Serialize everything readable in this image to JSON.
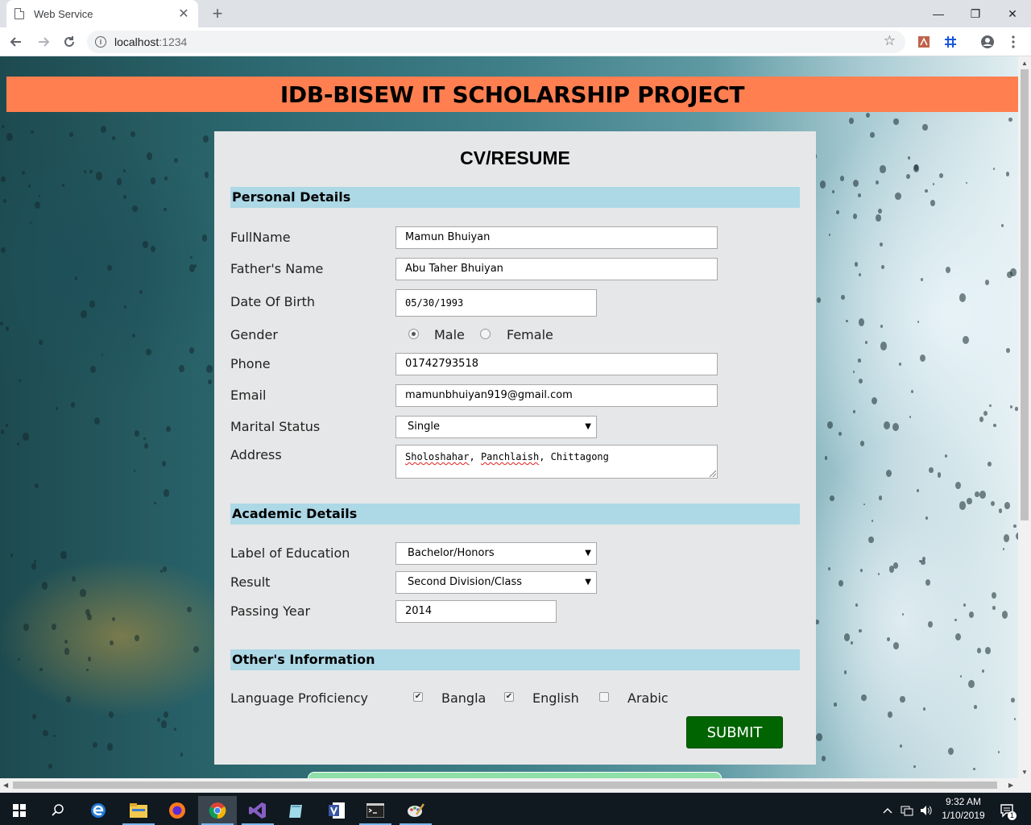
{
  "browser": {
    "tab_title": "Web Service",
    "tab_close": "✕",
    "new_tab": "+",
    "url_host": "localhost",
    "url_port": ":1234",
    "window_controls": {
      "minimize": "—",
      "restore": "❐",
      "close": "✕"
    }
  },
  "page": {
    "banner_title": "IDB-BISEW IT SCHOLARSHIP PROJECT",
    "form_title": "CV/RESUME",
    "sections": {
      "personal": "Personal Details",
      "academic": "Academic Details",
      "other": "Other's Information"
    },
    "personal": {
      "fullname_label": "FullName",
      "fullname_value": "Mamun Bhuiyan",
      "father_label": "Father's Name",
      "father_value": "Abu Taher Bhuiyan",
      "dob_label": "Date Of Birth",
      "dob_value": "05/30/1993",
      "gender_label": "Gender",
      "gender_options": [
        "Male",
        "Female"
      ],
      "gender_selected": "Male",
      "phone_label": "Phone",
      "phone_value": "01742793518",
      "email_label": "Email",
      "email_value": "mamunbhuiyan919@gmail.com",
      "marital_label": "Marital Status",
      "marital_value": "Single",
      "address_label": "Address",
      "address_parts": [
        "Sholoshahar",
        ", ",
        "Panchlaish",
        ", Chittagong"
      ]
    },
    "academic": {
      "education_label": "Label of Education",
      "education_value": "Bachelor/Honors",
      "result_label": "Result",
      "result_value": "Second Division/Class",
      "passing_label": "Passing Year",
      "passing_value": "2014"
    },
    "other": {
      "language_label": "Language Proficiency",
      "languages": [
        {
          "name": "Bangla",
          "checked": true
        },
        {
          "name": "English",
          "checked": true
        },
        {
          "name": "Arabic",
          "checked": false
        }
      ]
    },
    "submit_label": "SUBMIT"
  },
  "taskbar": {
    "time": "9:32 AM",
    "date": "1/10/2019",
    "notification_count": "1"
  },
  "colors": {
    "banner": "#ff7f50",
    "section_bar": "#add8e6",
    "submit": "#006400",
    "card": "#e6e7e8"
  }
}
